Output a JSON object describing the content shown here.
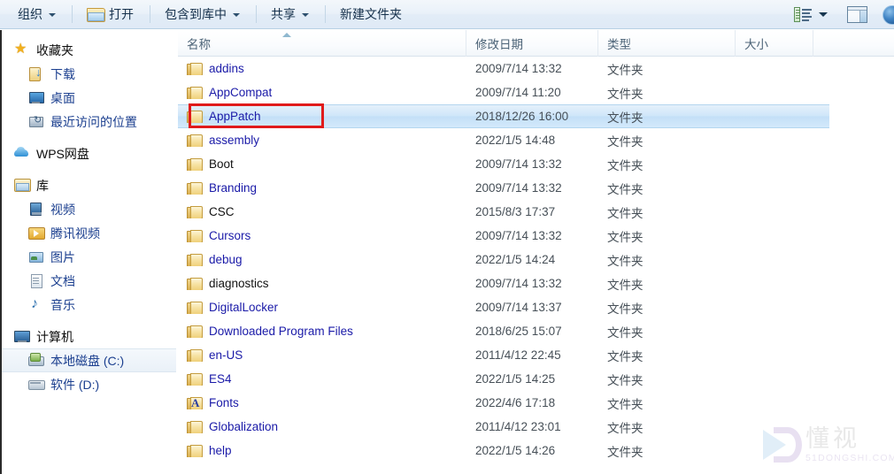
{
  "toolbar": {
    "organize": {
      "label": "组织",
      "has_caret": true
    },
    "open": {
      "label": "打开",
      "icon": "folder-open-icon"
    },
    "include_in_library": {
      "label": "包含到库中",
      "has_caret": true
    },
    "share": {
      "label": "共享",
      "has_caret": true
    },
    "new_folder": {
      "label": "新建文件夹"
    },
    "view_icon": "views-icon",
    "preview_pane_icon": "preview-pane-icon",
    "help_icon": "help-icon"
  },
  "sidebar": {
    "groups": [
      {
        "root": {
          "label": "收藏夹",
          "icon": "star-icon",
          "icon_class": "i-star",
          "glyph": "★"
        },
        "items": [
          {
            "label": "下载",
            "icon": "download-folder-icon",
            "icon_class": "i-download",
            "selected": false
          },
          {
            "label": "桌面",
            "icon": "desktop-icon",
            "icon_class": "i-desktop",
            "selected": false
          },
          {
            "label": "最近访问的位置",
            "icon": "recent-places-icon",
            "icon_class": "i-recent",
            "selected": false
          }
        ]
      },
      {
        "root": {
          "label": "WPS网盘",
          "icon": "cloud-icon",
          "icon_class": "i-cloud",
          "is_cloud": true
        },
        "items": []
      },
      {
        "root": {
          "label": "库",
          "icon": "library-icon",
          "icon_class": "i-library"
        },
        "items": [
          {
            "label": "视频",
            "icon": "video-icon",
            "icon_class": "i-video",
            "selected": false
          },
          {
            "label": "腾讯视频",
            "icon": "tencent-video-icon",
            "icon_class": "i-tencent",
            "selected": false
          },
          {
            "label": "图片",
            "icon": "pictures-icon",
            "icon_class": "i-picture",
            "selected": false
          },
          {
            "label": "文档",
            "icon": "documents-icon",
            "icon_class": "i-doc",
            "selected": false
          },
          {
            "label": "音乐",
            "icon": "music-icon",
            "icon_class": "i-music",
            "selected": false
          }
        ]
      },
      {
        "root": {
          "label": "计算机",
          "icon": "computer-icon",
          "icon_class": "i-computer"
        },
        "items": [
          {
            "label": "本地磁盘 (C:)",
            "icon": "hard-disk-c-icon",
            "icon_class": "i-hdd-c",
            "selected": true
          },
          {
            "label": "软件 (D:)",
            "icon": "hard-disk-d-icon",
            "icon_class": "i-hdd-d",
            "selected": false
          }
        ]
      }
    ]
  },
  "file_list": {
    "columns": [
      {
        "key": "name",
        "label": "名称",
        "sorted": true,
        "sort_direction": "ascending"
      },
      {
        "key": "date",
        "label": "修改日期",
        "sorted": false
      },
      {
        "key": "type",
        "label": "类型",
        "sorted": false
      },
      {
        "key": "size",
        "label": "大小",
        "sorted": false
      }
    ],
    "rows": [
      {
        "name": "addins",
        "date": "2009/7/14 13:32",
        "type": "文件夹",
        "size": "",
        "selected": false,
        "name_color": "blue",
        "icon": "folder-icon"
      },
      {
        "name": "AppCompat",
        "date": "2009/7/14 11:20",
        "type": "文件夹",
        "size": "",
        "selected": false,
        "name_color": "blue",
        "icon": "folder-icon"
      },
      {
        "name": "AppPatch",
        "date": "2018/12/26 16:00",
        "type": "文件夹",
        "size": "",
        "selected": true,
        "name_color": "blue",
        "icon": "folder-icon",
        "annotated": true
      },
      {
        "name": "assembly",
        "date": "2022/1/5 14:48",
        "type": "文件夹",
        "size": "",
        "selected": false,
        "name_color": "blue",
        "icon": "folder-icon"
      },
      {
        "name": "Boot",
        "date": "2009/7/14 13:32",
        "type": "文件夹",
        "size": "",
        "selected": false,
        "name_color": "black",
        "icon": "folder-icon"
      },
      {
        "name": "Branding",
        "date": "2009/7/14 13:32",
        "type": "文件夹",
        "size": "",
        "selected": false,
        "name_color": "blue",
        "icon": "folder-icon"
      },
      {
        "name": "CSC",
        "date": "2015/8/3 17:37",
        "type": "文件夹",
        "size": "",
        "selected": false,
        "name_color": "black",
        "icon": "folder-icon"
      },
      {
        "name": "Cursors",
        "date": "2009/7/14 13:32",
        "type": "文件夹",
        "size": "",
        "selected": false,
        "name_color": "blue",
        "icon": "folder-icon"
      },
      {
        "name": "debug",
        "date": "2022/1/5 14:24",
        "type": "文件夹",
        "size": "",
        "selected": false,
        "name_color": "blue",
        "icon": "folder-icon"
      },
      {
        "name": "diagnostics",
        "date": "2009/7/14 13:32",
        "type": "文件夹",
        "size": "",
        "selected": false,
        "name_color": "black",
        "icon": "folder-icon"
      },
      {
        "name": "DigitalLocker",
        "date": "2009/7/14 13:37",
        "type": "文件夹",
        "size": "",
        "selected": false,
        "name_color": "blue",
        "icon": "folder-icon"
      },
      {
        "name": "Downloaded Program Files",
        "date": "2018/6/25 15:07",
        "type": "文件夹",
        "size": "",
        "selected": false,
        "name_color": "blue",
        "icon": "folder-icon"
      },
      {
        "name": "en-US",
        "date": "2011/4/12 22:45",
        "type": "文件夹",
        "size": "",
        "selected": false,
        "name_color": "blue",
        "icon": "folder-icon"
      },
      {
        "name": "ES4",
        "date": "2022/1/5 14:25",
        "type": "文件夹",
        "size": "",
        "selected": false,
        "name_color": "blue",
        "icon": "folder-icon"
      },
      {
        "name": "Fonts",
        "date": "2022/4/6 17:18",
        "type": "文件夹",
        "size": "",
        "selected": false,
        "name_color": "blue",
        "icon": "fonts-folder-icon",
        "glyph": "A"
      },
      {
        "name": "Globalization",
        "date": "2011/4/12 23:01",
        "type": "文件夹",
        "size": "",
        "selected": false,
        "name_color": "blue",
        "icon": "folder-icon"
      },
      {
        "name": "help",
        "date": "2022/1/5 14:26",
        "type": "文件夹",
        "size": "",
        "selected": false,
        "name_color": "blue",
        "icon": "folder-icon"
      }
    ]
  },
  "watermark": {
    "cn_text": "懂视",
    "en_text": "51DONGSHI.COM"
  },
  "colors": {
    "selection_blue": "#c3dff7",
    "annotation_red": "#e01b1b",
    "link_blue": "#1a1aa8",
    "toolbar_blue": "#e2ecf7"
  }
}
